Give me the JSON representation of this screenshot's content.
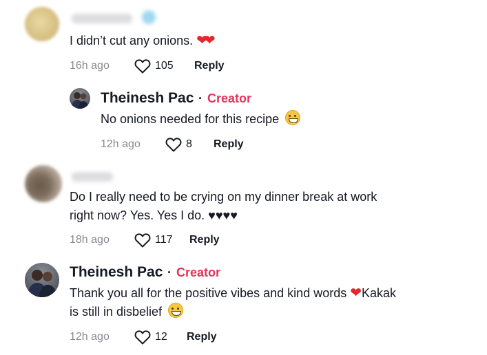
{
  "comments": [
    {
      "text": "I didn’t cut any onions.",
      "emoji": "❤❤",
      "time": "16h ago",
      "likes": "105",
      "reply_label": "Reply"
    },
    {
      "username": "Theinesh Pac",
      "separator": "·",
      "badge": "Creator",
      "text": "No onions needed for this recipe",
      "time": "12h ago",
      "likes": "8",
      "reply_label": "Reply"
    },
    {
      "text_line1": "Do I really need to be crying on my dinner break at work",
      "text_line2": "right now? Yes. Yes I do. ♥♥♥♥",
      "time": "18h ago",
      "likes": "117",
      "reply_label": "Reply"
    },
    {
      "username": "Theinesh Pac",
      "separator": "·",
      "badge": "Creator",
      "text_line1_a": "Thank you all for the positive vibes and kind words ",
      "text_line1_emoji": "❤",
      "text_line1_b": "Kakak",
      "text_line2": "is still in disbelief",
      "time": "12h ago",
      "likes": "12",
      "reply_label": "Reply"
    }
  ],
  "colors": {
    "creator_badge": "#e0355a",
    "meta_text": "#8a8b91",
    "heart_emoji": "#e5262d"
  }
}
